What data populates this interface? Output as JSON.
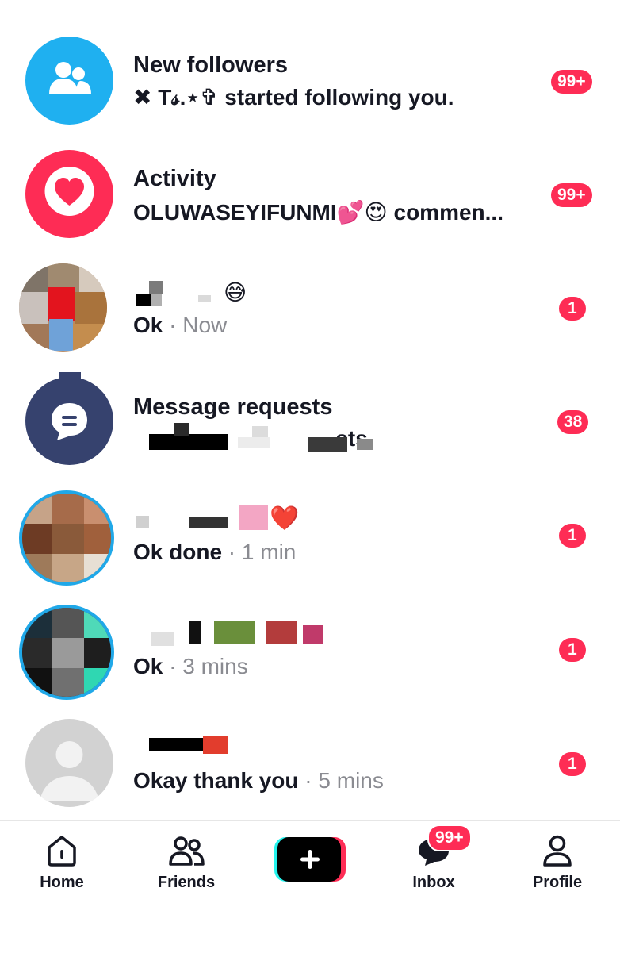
{
  "rows": [
    {
      "title": "New followers",
      "subtitle": "✖ T𝓈.⋆✞ started following you.",
      "badge": "99+"
    },
    {
      "title": "Activity",
      "subtitle": "OLUWASEYIFUNMI💕😍 commen...",
      "badge": "99+"
    },
    {
      "title_emoji": "😅",
      "message": "Ok",
      "separator": "·",
      "time": "Now",
      "badge": "1"
    },
    {
      "title": "Message requests",
      "subtitle_partial": "...sts",
      "badge": "38"
    },
    {
      "title_emoji": "❤️",
      "message": "Ok done",
      "separator": "·",
      "time": "1 min",
      "badge": "1"
    },
    {
      "message": "Ok",
      "separator": "·",
      "time": "3 mins",
      "badge": "1"
    },
    {
      "message": "Okay thank you",
      "separator": "·",
      "time": "5 mins",
      "badge": "1"
    }
  ],
  "nav": {
    "home": "Home",
    "friends": "Friends",
    "inbox": "Inbox",
    "inbox_badge": "99+",
    "profile": "Profile"
  },
  "colors": {
    "accent": "#fe2c55",
    "followers_avatar": "#1fb0f0",
    "activity_avatar": "#fe2c55",
    "requests_avatar": "#36426e",
    "secondary_text": "#8a8b91"
  },
  "icons": {
    "followers": "people-icon",
    "activity": "heart-icon",
    "requests": "chat-bubble-icon",
    "home": "home-icon",
    "friends": "friends-icon",
    "create": "plus-icon",
    "inbox": "inbox-icon",
    "profile": "profile-icon"
  }
}
